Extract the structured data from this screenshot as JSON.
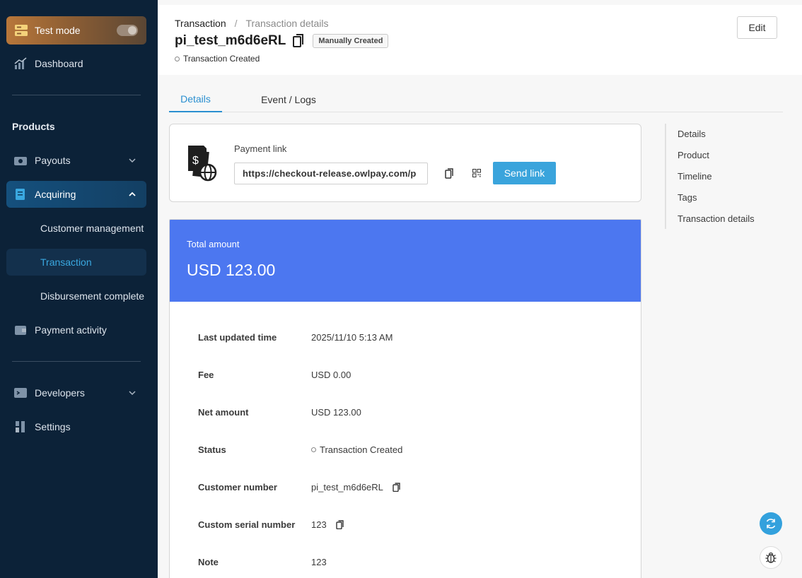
{
  "sidebar": {
    "test_mode_label": "Test mode",
    "dashboard": "Dashboard",
    "section_products": "Products",
    "payouts": "Payouts",
    "acquiring": "Acquiring",
    "customer_management": "Customer management",
    "transaction": "Transaction",
    "disbursement_complete": "Disbursement complete",
    "payment_activity": "Payment activity",
    "developers": "Developers",
    "settings": "Settings"
  },
  "header": {
    "breadcrumb_root": "Transaction",
    "breadcrumb_sep": "/",
    "breadcrumb_current": "Transaction details",
    "transaction_id": "pi_test_m6d6eRL",
    "badge": "Manually Created",
    "status": "Transaction Created",
    "edit_label": "Edit"
  },
  "tabs": {
    "details": "Details",
    "events": "Event / Logs"
  },
  "payment_link": {
    "label": "Payment link",
    "url": "https://checkout-release.owlpay.com/p",
    "send_label": "Send link"
  },
  "amount": {
    "title": "Total amount",
    "value": "USD 123.00"
  },
  "details": {
    "last_updated_label": "Last updated time",
    "last_updated_value": "2025/11/10 5:13 AM",
    "fee_label": "Fee",
    "fee_value": "USD 0.00",
    "net_label": "Net amount",
    "net_value": "USD 123.00",
    "status_label": "Status",
    "status_value": "Transaction Created",
    "customer_label": "Customer number",
    "customer_value": "pi_test_m6d6eRL",
    "serial_label": "Custom serial number",
    "serial_value": "123",
    "note_label": "Note",
    "note_value": "123"
  },
  "toc": {
    "items": [
      "Details",
      "Product",
      "Timeline",
      "Tags",
      "Transaction details"
    ]
  },
  "colors": {
    "sidebar_bg": "#0c2238",
    "accent": "#3aa4dc",
    "amount_bg": "#4c77f0",
    "test_mode": "#b8773a"
  }
}
